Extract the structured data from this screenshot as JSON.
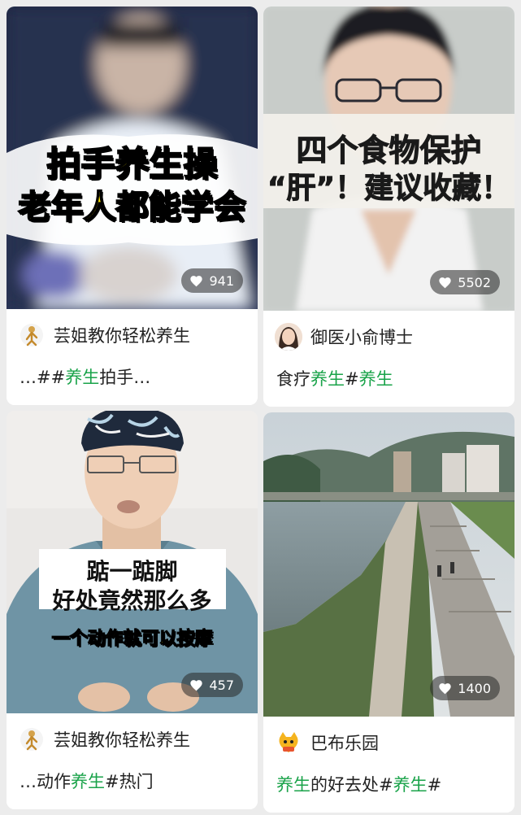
{
  "cards": [
    {
      "likes": "941",
      "overlay": [
        "拍手养生操",
        "老年人都能学会"
      ],
      "author": "芸姐教你轻松养生",
      "desc": [
        "…##",
        "养生",
        "拍手…"
      ]
    },
    {
      "likes": "5502",
      "overlay": [
        "四个食物保护",
        "“肝”！建议收藏！"
      ],
      "author": "御医小俞博士",
      "desc": [
        "食疗",
        "养生",
        "#",
        "养生"
      ]
    },
    {
      "likes": "457",
      "overlay": [
        "踮一踮脚",
        "好处竟然那么多",
        "一个动作就可以按摩"
      ],
      "author": "芸姐教你轻松养生",
      "desc": [
        "…动作",
        "养生",
        "#热门"
      ]
    },
    {
      "likes": "1400",
      "author": "巴布乐园",
      "desc": [
        "养生",
        "的好去处#",
        "养生",
        "#"
      ]
    }
  ],
  "icons": {
    "likes": "heart-icon",
    "avatar_1": "cartoon-figure-avatar",
    "avatar_2": "woman-portrait-avatar",
    "avatar_4": "cat-logo-avatar"
  },
  "colors": {
    "tag_green": "#1aa34a",
    "caption_yellow": "#ffe600",
    "background": "#ececec"
  }
}
